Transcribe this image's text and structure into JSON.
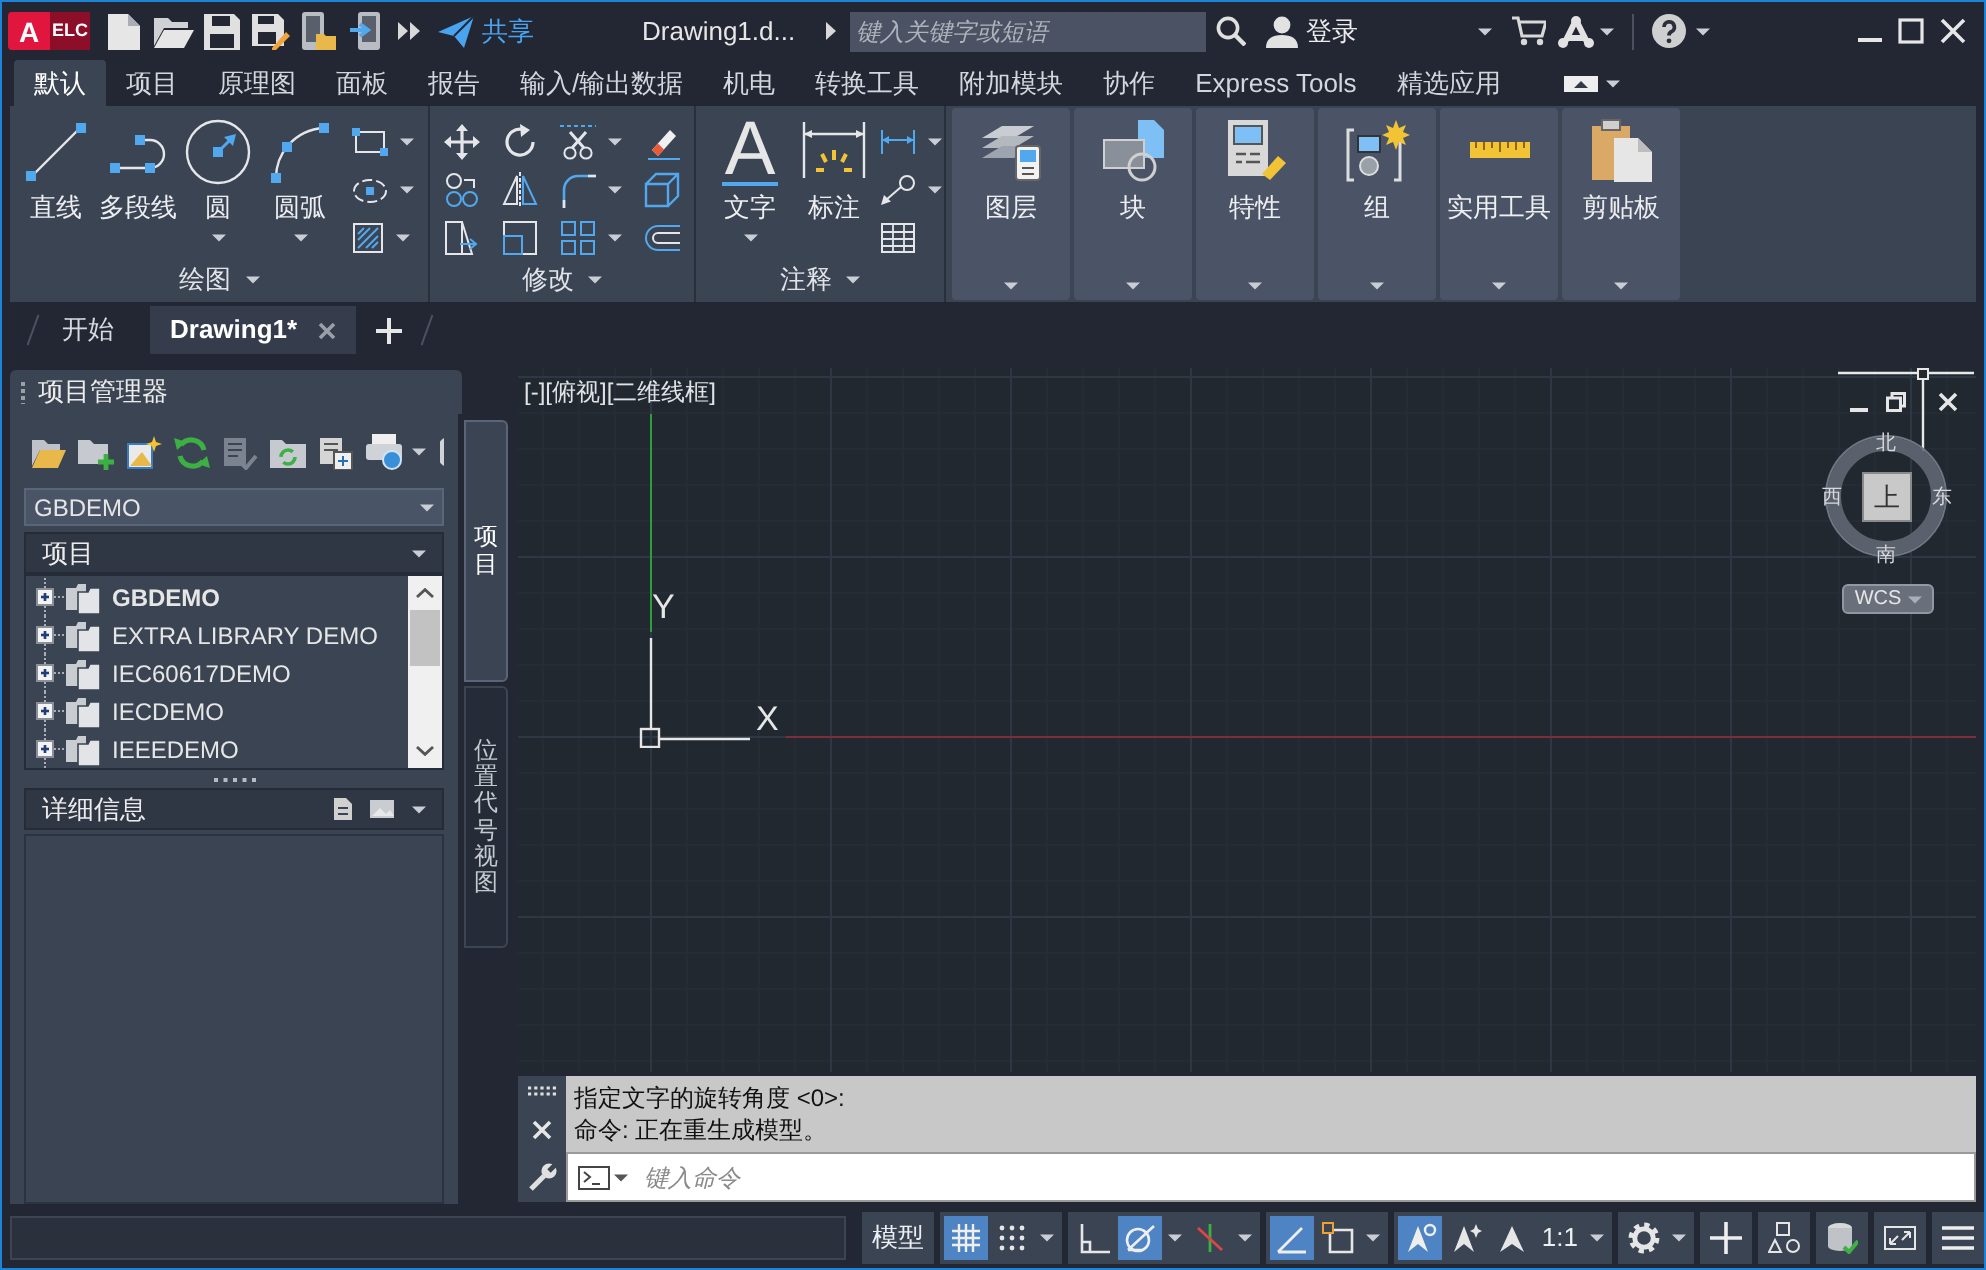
{
  "title_bar": {
    "app_logo": {
      "letter": "A",
      "badge": "ELC"
    },
    "share": "共享",
    "title": "Drawing1.d...",
    "search": {
      "placeholder": "键入关键字或短语"
    },
    "sign_in": "登录"
  },
  "ribbon_tabs": [
    {
      "label": "默认",
      "selected": true
    },
    {
      "label": "项目",
      "selected": false
    },
    {
      "label": "原理图",
      "selected": false
    },
    {
      "label": "面板",
      "selected": false
    },
    {
      "label": "报告",
      "selected": false
    },
    {
      "label": "输入/输出数据",
      "selected": false
    },
    {
      "label": "机电",
      "selected": false
    },
    {
      "label": "转换工具",
      "selected": false
    },
    {
      "label": "附加模块",
      "selected": false
    },
    {
      "label": "协作",
      "selected": false
    },
    {
      "label": "Express Tools",
      "selected": false
    },
    {
      "label": "精选应用",
      "selected": false
    }
  ],
  "ribbon": {
    "draw": {
      "title": "绘图",
      "tools": [
        {
          "kind": "line",
          "label": "直线",
          "dropdown": false
        },
        {
          "kind": "polyline",
          "label": "多段线",
          "dropdown": false
        },
        {
          "kind": "circle",
          "label": "圆",
          "dropdown": true
        },
        {
          "kind": "arc",
          "label": "圆弧",
          "dropdown": true
        }
      ]
    },
    "modify": {
      "title": "修改"
    },
    "annotation": {
      "title": "注释",
      "tools": [
        {
          "kind": "text",
          "label": "文字",
          "glyph": "A",
          "dropdown": true
        },
        {
          "kind": "dimension",
          "label": "标注",
          "dropdown": false
        }
      ]
    },
    "buttons": [
      {
        "kind": "layers",
        "label": "图层"
      },
      {
        "kind": "block",
        "label": "块"
      },
      {
        "kind": "properties",
        "label": "特性"
      },
      {
        "kind": "group",
        "label": "组"
      },
      {
        "kind": "utilities",
        "label": "实用工具"
      },
      {
        "kind": "clipboard",
        "label": "剪贴板"
      }
    ]
  },
  "file_tabs": [
    {
      "label": "开始",
      "selected": false
    },
    {
      "label": "Drawing1*",
      "selected": true
    }
  ],
  "project_manager": {
    "title": "项目管理器",
    "current_project": "GBDEMO",
    "projects_header": "项目",
    "projects": [
      {
        "label": "GBDEMO",
        "active": true,
        "expanded": false
      },
      {
        "label": "EXTRA LIBRARY DEMO",
        "active": false,
        "expanded": false
      },
      {
        "label": "IEC60617DEMO",
        "active": false,
        "expanded": false
      },
      {
        "label": "IECDEMO",
        "active": false,
        "expanded": false
      },
      {
        "label": "IEEEDEMO",
        "active": false,
        "expanded": false
      }
    ],
    "details_header": "详细信息",
    "side_tabs": [
      {
        "label": "项目",
        "selected": true
      },
      {
        "label": "位置代号视图",
        "selected": false
      }
    ]
  },
  "viewport": {
    "controls": [
      "[-]",
      "[俯视]",
      "[二维线框]"
    ],
    "ucs": {
      "y_label": "Y",
      "x_label": "X"
    },
    "viewcube": {
      "north": "北",
      "west": "西",
      "east": "东",
      "south": "南",
      "face": "上",
      "coordinate_system": "WCS"
    }
  },
  "command_line": {
    "history": [
      "指定文字的旋转角度 <0>:",
      "命令: 正在重生成模型。"
    ],
    "placeholder": "键入命令"
  },
  "status_bar": {
    "groups": [
      {
        "items": [
          {
            "kind": "text",
            "label": "模型"
          }
        ]
      },
      {
        "items": [
          {
            "kind": "grid",
            "on": true
          },
          {
            "kind": "snap",
            "on": false
          },
          {
            "kind": "caret"
          }
        ]
      },
      {
        "items": [
          {
            "kind": "ortho",
            "on": false
          },
          {
            "kind": "polar",
            "on": true
          },
          {
            "kind": "caret"
          },
          {
            "kind": "isodraft",
            "on": false
          },
          {
            "kind": "caret"
          }
        ]
      },
      {
        "items": [
          {
            "kind": "otrack",
            "on": true
          },
          {
            "kind": "osnap",
            "on": false
          },
          {
            "kind": "caret"
          }
        ]
      },
      {
        "items": [
          {
            "kind": "annovis",
            "on": true
          },
          {
            "kind": "autoscale",
            "on": false
          },
          {
            "kind": "annoscale",
            "on": false
          },
          {
            "kind": "text",
            "label": "1:1"
          },
          {
            "kind": "caret"
          }
        ]
      },
      {
        "items": [
          {
            "kind": "gear"
          },
          {
            "kind": "caret"
          }
        ]
      },
      {
        "items": [
          {
            "kind": "plus"
          }
        ]
      },
      {
        "items": [
          {
            "kind": "isolate"
          }
        ]
      },
      {
        "items": [
          {
            "kind": "hardware"
          }
        ]
      },
      {
        "items": [
          {
            "kind": "fullscreen"
          }
        ]
      },
      {
        "items": [
          {
            "kind": "menu"
          }
        ]
      }
    ]
  }
}
